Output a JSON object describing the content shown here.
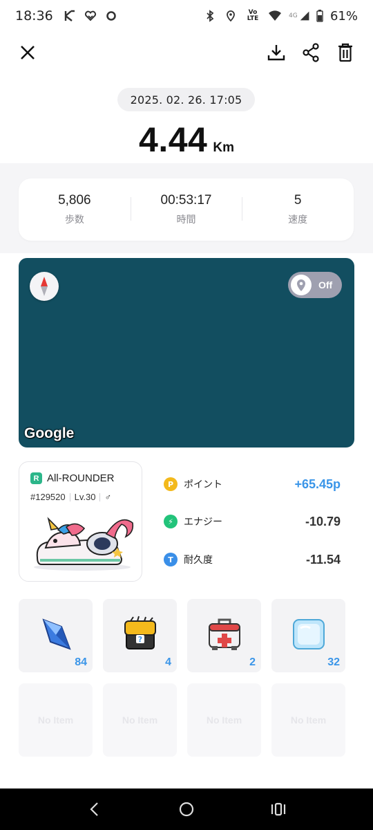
{
  "status_bar": {
    "time": "18:36",
    "left_icons": [
      "k-app-icon",
      "heart-app-icon",
      "circle-app-icon"
    ],
    "right_icons": [
      "bluetooth-icon",
      "location-icon",
      "volte-icon",
      "wifi-icon",
      "signal-4g-icon",
      "battery-icon"
    ],
    "volte_label": "Vo LTE",
    "network_label": "4G",
    "battery": "61%"
  },
  "toolbar": {
    "close": "close-icon",
    "download": "download-icon",
    "share": "share-icon",
    "delete": "trash-icon"
  },
  "activity": {
    "date": "2025. 02. 26. 17:05",
    "distance": "4.44",
    "distance_unit": "Km"
  },
  "stats": [
    {
      "value": "5,806",
      "label": "歩数"
    },
    {
      "value": "00:53:17",
      "label": "時間"
    },
    {
      "value": "5",
      "label": "速度"
    }
  ],
  "map": {
    "toggle_label": "Off",
    "attribution": "Google",
    "background_color": "#124e60"
  },
  "character": {
    "rarity": "R",
    "name": "All-ROUNDER",
    "id": "#129520",
    "level": "Lv.30",
    "gender_symbol": "♂"
  },
  "rewards": [
    {
      "icon_letter": "P",
      "icon": "point-icon",
      "label": "ポイント",
      "value": "+65.45p",
      "color": "#f3b91c"
    },
    {
      "icon_letter": "⚡",
      "icon": "energy-icon",
      "label": "エナジー",
      "value": "-10.79",
      "color": "#22c37a"
    },
    {
      "icon_letter": "T",
      "icon": "durability-icon",
      "label": "耐久度",
      "value": "-11.54",
      "color": "#3a8fe8"
    }
  ],
  "items": [
    {
      "name": "blue-crystal",
      "count": "84"
    },
    {
      "name": "mystery-box",
      "count": "4"
    },
    {
      "name": "repair-kit",
      "count": "2"
    },
    {
      "name": "ice-cube",
      "count": "32"
    }
  ],
  "empty_items": [
    "No Item",
    "No Item",
    "No Item",
    "No Item"
  ],
  "nav": [
    "back-icon",
    "home-icon",
    "recents-icon"
  ]
}
